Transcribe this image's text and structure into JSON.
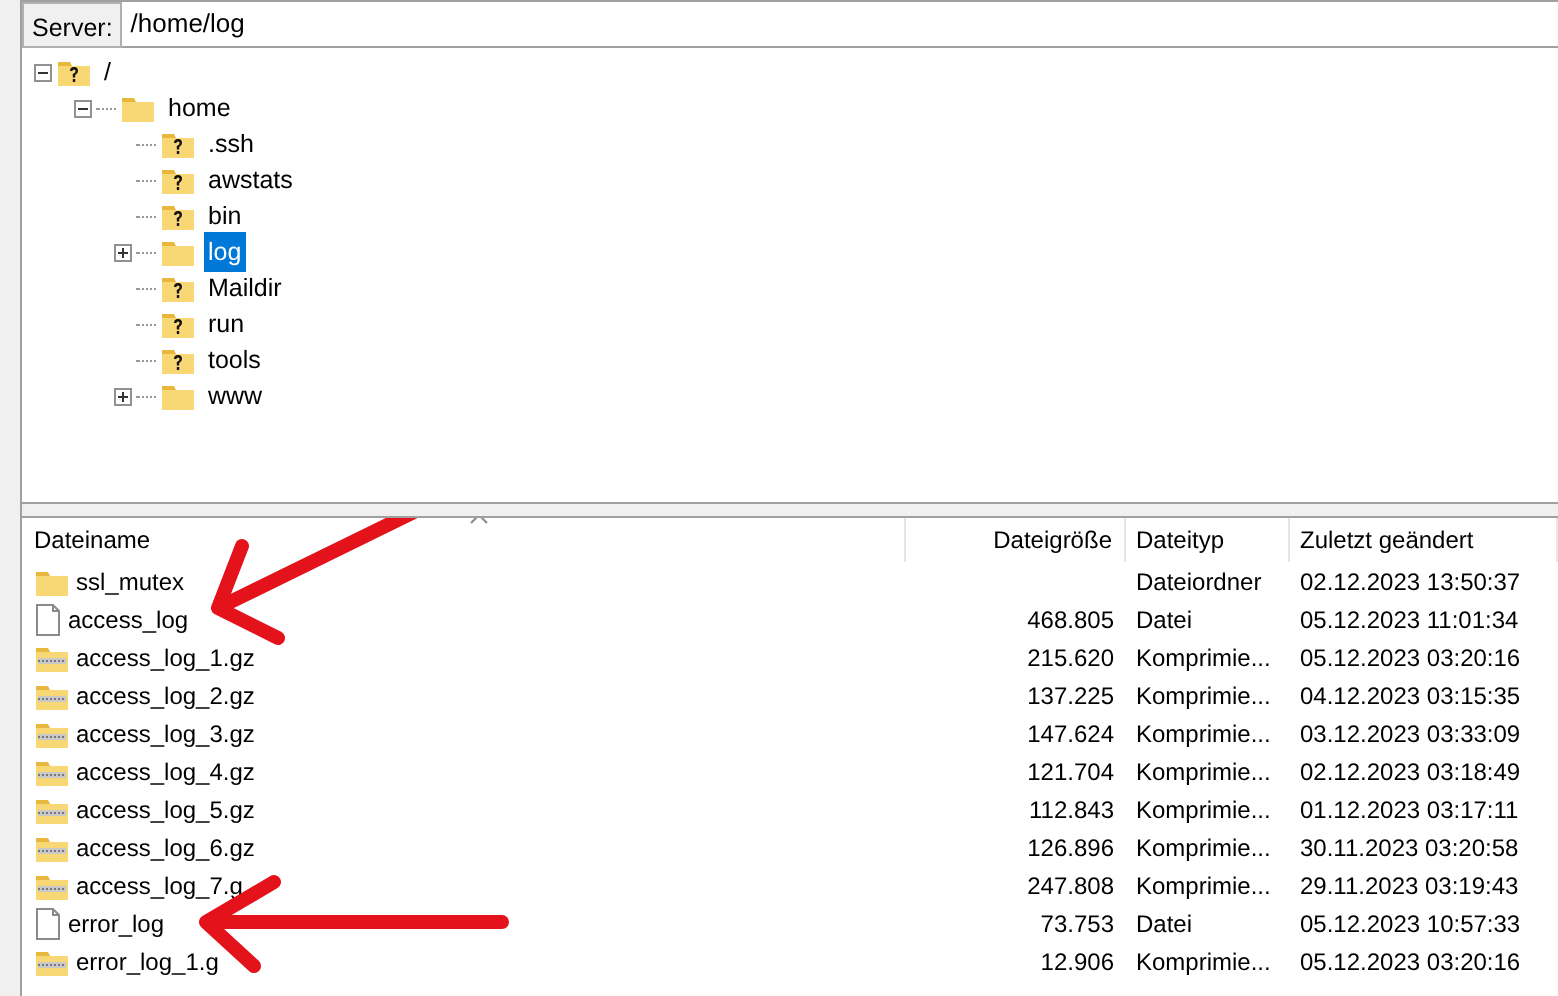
{
  "server": {
    "label": "Server:",
    "value": "/home/log"
  },
  "tree": [
    {
      "label": "/",
      "kind": "unknown",
      "expanded": true,
      "selected": false,
      "children": [
        {
          "label": "home",
          "kind": "folder",
          "expanded": true,
          "selected": false,
          "children": [
            {
              "label": ".ssh",
              "kind": "unknown",
              "selected": false
            },
            {
              "label": "awstats",
              "kind": "unknown",
              "selected": false
            },
            {
              "label": "bin",
              "kind": "unknown",
              "selected": false
            },
            {
              "label": "log",
              "kind": "folder",
              "expanded": false,
              "selected": true
            },
            {
              "label": "Maildir",
              "kind": "unknown",
              "selected": false
            },
            {
              "label": "run",
              "kind": "unknown",
              "selected": false
            },
            {
              "label": "tools",
              "kind": "unknown",
              "selected": false
            },
            {
              "label": "www",
              "kind": "folder",
              "expanded": false,
              "selected": false
            }
          ]
        }
      ]
    }
  ],
  "table": {
    "columns": [
      "Dateiname",
      "Dateigröße",
      "Dateityp",
      "Zuletzt geändert"
    ],
    "rows": [
      {
        "kind": "folder",
        "cells": [
          "ssl_mutex",
          "",
          "Dateiordner",
          "02.12.2023 13:50:37"
        ]
      },
      {
        "kind": "file",
        "arrow": true,
        "cells": [
          "access_log",
          "468.805",
          "Datei",
          "05.12.2023 11:01:34"
        ]
      },
      {
        "kind": "archive",
        "cells": [
          "access_log_1.gz",
          "215.620",
          "Komprimie...",
          "05.12.2023 03:20:16"
        ]
      },
      {
        "kind": "archive",
        "cells": [
          "access_log_2.gz",
          "137.225",
          "Komprimie...",
          "04.12.2023 03:15:35"
        ]
      },
      {
        "kind": "archive",
        "cells": [
          "access_log_3.gz",
          "147.624",
          "Komprimie...",
          "03.12.2023 03:33:09"
        ]
      },
      {
        "kind": "archive",
        "cells": [
          "access_log_4.gz",
          "121.704",
          "Komprimie...",
          "02.12.2023 03:18:49"
        ]
      },
      {
        "kind": "archive",
        "cells": [
          "access_log_5.gz",
          "112.843",
          "Komprimie...",
          "01.12.2023 03:17:11"
        ]
      },
      {
        "kind": "archive",
        "cells": [
          "access_log_6.gz",
          "126.896",
          "Komprimie...",
          "30.11.2023 03:20:58"
        ]
      },
      {
        "kind": "archive",
        "cells": [
          "access_log_7.g",
          "247.808",
          "Komprimie...",
          "29.11.2023 03:19:43"
        ]
      },
      {
        "kind": "file",
        "arrow": true,
        "cells": [
          "error_log",
          "73.753",
          "Datei",
          "05.12.2023 10:57:33"
        ]
      },
      {
        "kind": "archive",
        "cells": [
          "error_log_1.g",
          "12.906",
          "Komprimie...",
          "05.12.2023 03:20:16"
        ]
      }
    ]
  }
}
